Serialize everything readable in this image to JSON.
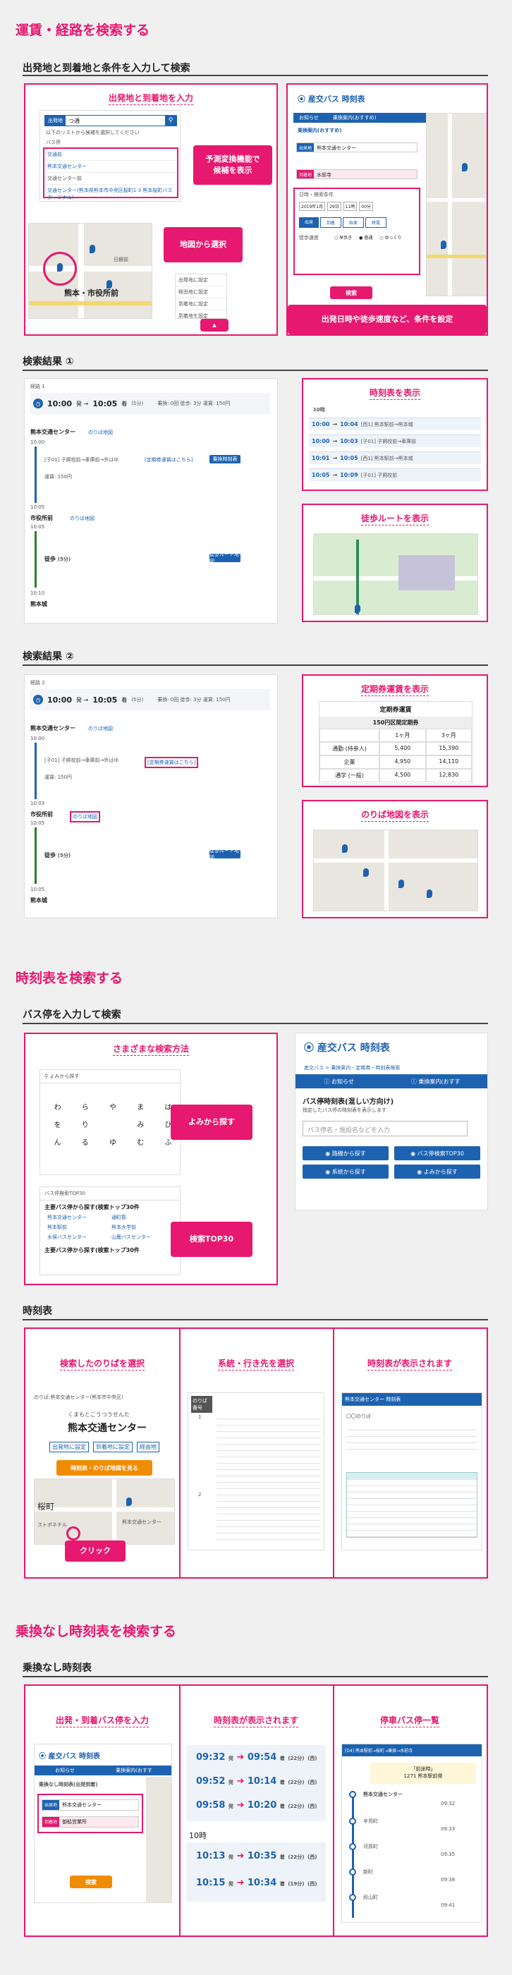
{
  "sections": {
    "route_title": "運賃・経路を検索する",
    "route_sub": "出発地と到着地と条件を入力して検索",
    "result1_sub": "検索結果 ①",
    "result2_sub": "検索結果 ②",
    "timetable_title": "時刻表を検索する",
    "busstop_sub": "バス停を入力して検索",
    "timetable_sub": "時刻表",
    "direct_title": "乗換なし時刻表を検索する",
    "direct_sub": "乗換なし時刻表"
  },
  "route_panel": {
    "left_title": "出発地と到着地を入力",
    "callout_predict": "予測変換機能で\n候補を表示",
    "callout_map": "地図から選択",
    "search_tag": "出発地",
    "search_value": "つ通",
    "hint": "以下のリストから候補を選択してください",
    "group_label": "バス停",
    "candidates": [
      "交通前",
      "熊本交通センター",
      "交通センター前",
      "交通センター(熊本県熊本市中央区桜町1-3 熊本桜町バスターミナル)"
    ],
    "map_label1": "熊本・市役所前",
    "map_label2": "日銀前",
    "map_menu": [
      "出発地に設定",
      "経由地に設定",
      "到着地に設定"
    ],
    "map_menu_sub": "到着地を設定",
    "logo": "産交バス 時刻表",
    "callout_conditions": "出発日時や徒歩速度など、条件を設定",
    "right_nav": [
      "お知らせ",
      "乗換案内(おすすめ)"
    ],
    "route_heading": "乗換案内(おすすめ)",
    "from_tag": "出発地",
    "from_value": "熊本交通センター",
    "to_tag": "到着地",
    "to_value": "水前寺",
    "date_label": "日時・検索条件",
    "date_value": "2019年1月",
    "day_value": "29日",
    "hour_value": "11時",
    "min_value": "00分",
    "time_opts": [
      "出発",
      "到着",
      "始発",
      "終電"
    ],
    "walk_label": "徒歩速度",
    "walk_opts": [
      "早歩き",
      "普通",
      "ゆっくり"
    ],
    "search_btn": "検索"
  },
  "result1": {
    "label": "経路 1",
    "depart": "10:00",
    "arrive": "10:05",
    "duration": "(5分)",
    "summary": "乗換: 0回  徒歩: 3分  運賃: 150円",
    "stop1": "熊本交通センター",
    "stop1_link": "のりば地図",
    "t1": "10:00",
    "bus_line": "[子01] 子飼校前→車庫前→外はゆ",
    "timetable_link": "[定期券運賃はこちら]",
    "bus_btn": "乗換時刻表",
    "fare": "運賃: 150円",
    "t2": "10:05",
    "stop2": "市役所前",
    "stop2_link": "のりば地図",
    "t3": "10:05",
    "walk_text": "徒歩",
    "walk_time": "(5分)",
    "walk_btn": "徒歩ルート地図",
    "t4": "10:10",
    "stop3": "熊本城",
    "tt_title": "時刻表を表示",
    "tt_hour": "10時",
    "tt_rows": [
      {
        "dep": "10:00",
        "arr": "10:04",
        "text": "[西1] 熊本駅前→熊本城"
      },
      {
        "dep": "10:00",
        "arr": "10:03",
        "text": "[子01] 子飼校前→車庫前"
      },
      {
        "dep": "10:01",
        "arr": "10:05",
        "text": "[西1] 熊本駅前→熊本城"
      },
      {
        "dep": "10:05",
        "arr": "10:09",
        "text": "[子01] 子飼校前"
      }
    ],
    "walk_title": "徒歩ルートを表示"
  },
  "result2": {
    "label": "経路 2",
    "depart": "10:00",
    "arrive": "10:05",
    "duration": "(5分)",
    "summary": "乗換: 0回  徒歩: 3分  運賃: 150円",
    "stop1": "熊本交通センター",
    "stop1_link": "のりば地図",
    "t1": "10:00",
    "bus_line": "[子01] 子飼校前→車庫前→外はゆ",
    "timetable_link": "[定期券運賃はこちら]",
    "fare": "運賃: 150円",
    "t2": "10:03",
    "stop2": "市役所前",
    "stop2_link": "のりば地図",
    "t3": "10:05",
    "walk_text": "徒歩",
    "walk_time": "(5分)",
    "walk_btn": "徒歩ルート地図",
    "t4": "10:05",
    "stop3": "熊本城",
    "pass_title": "定期券運賃を表示",
    "pass_header": "定期券運賃",
    "pass_fare_label": "150円区間定期券",
    "pass_cols": [
      "",
      "1ヶ月",
      "3ヶ月"
    ],
    "pass_rows": [
      {
        "kind": "通勤 (持参人)",
        "m1": "5,400",
        "m3": "15,390"
      },
      {
        "kind": "企業",
        "m1": "4,950",
        "m3": "14,110"
      },
      {
        "kind": "通学 (一般)",
        "m1": "4,500",
        "m3": "12,830"
      }
    ],
    "stopmap_title": "のりば地図を表示"
  },
  "busstop": {
    "left_title": "さまざまな検索方法",
    "callout_kana": "よみから探す",
    "callout_top": "検索TOP30",
    "kana_hint": "よみから探す",
    "kana_rows": [
      [
        "わ",
        "ら",
        "や",
        "ま",
        "は"
      ],
      [
        "を",
        "り",
        "",
        "み",
        "ひ"
      ],
      [
        "ん",
        "る",
        "ゆ",
        "む",
        "ふ"
      ]
    ],
    "top_header": "バス停検索TOP30",
    "top_title": "主要バス停から探す(検索トップ30件",
    "top_items": [
      "熊本交通センター",
      "通町筋",
      "熊本駅前",
      "山鹿バスセンター",
      "熊本大学前",
      "水俣バスセンター"
    ],
    "top_title2": "主要バス停から探す(検索トップ30件",
    "logo": "産交バス 時刻表",
    "breadcrumb": "産交バス > 乗換案内・定期券・時刻表検索",
    "nav": [
      "お知らせ",
      "乗換案内(おすす"
    ],
    "heading": "バス停時刻表(混しい方向け)",
    "subtext": "指定したバス停の時刻表を表示します",
    "placeholder": "バス停名・施設名などを入力",
    "btns": [
      "路線から探す",
      "バス停検索TOP30",
      "系統から探す",
      "よみから探す"
    ]
  },
  "timetable": {
    "col1_title": "検索したのりばを選択",
    "col2_title": "系統・行き先を選択",
    "col3_title": "時刻表が表示されます",
    "col1_head": "のりば:熊本交通センター(熊本市中央区)",
    "col1_kana": "くまもとこうつうせんた",
    "col1_name": "熊本交通センター",
    "col1_links": [
      "出発地に設定",
      "到着地に設定",
      "経由地"
    ],
    "col1_btn": "時刻表・のりば地図を見る",
    "col1_map_labels": [
      "桜町",
      "ストポネチル",
      "熊本交通センター"
    ],
    "col1_callout": "クリック",
    "col2_head": "のりば番号",
    "col2_nums": [
      "1",
      "2"
    ],
    "col3_head": "熊本交通センター 時刻表",
    "col3_sub": "〇〇のりば"
  },
  "direct": {
    "col1_title": "出発・到着バス停を入力",
    "col2_title": "時刻表が表示されます",
    "col3_title": "停車バス停一覧",
    "logo": "産交バス 時刻表",
    "nav": [
      "お知らせ",
      "乗換案内(おすす"
    ],
    "heading": "乗換なし時刻表(出発到着)",
    "from_tag": "出発地",
    "from_value": "熊本交通センター",
    "to_tag": "到着地",
    "to_value": "御船営業所",
    "search_btn": "検索",
    "times_top": [
      {
        "dep": "09:32",
        "arr": "09:54",
        "dur": "(22分)"
      },
      {
        "dep": "09:52",
        "arr": "10:14",
        "dur": "(22分)"
      },
      {
        "dep": "09:58",
        "arr": "10:20",
        "dur": "(22分)"
      }
    ],
    "hour_label": "10時",
    "times_bottom": [
      {
        "dep": "10:13",
        "arr": "10:35",
        "dur": "(22分)"
      },
      {
        "dep": "10:15",
        "arr": "10:34",
        "dur": "(19分)"
      }
    ],
    "via": "(西)",
    "stops_header": "[D4] 熊本駅前→桜町→乗換→水前寺",
    "stops_note1": "「前途時」",
    "stops_note2": "1271 熊本駅前発",
    "stops": [
      {
        "name": "熊本交通センター",
        "time": "09:32"
      },
      {
        "name": "辛島町",
        "time": "09:33"
      },
      {
        "name": "河原町",
        "time": "09:35"
      },
      {
        "name": "新町",
        "time": "09:38"
      },
      {
        "name": "段山町",
        "time": "09:41"
      }
    ]
  }
}
